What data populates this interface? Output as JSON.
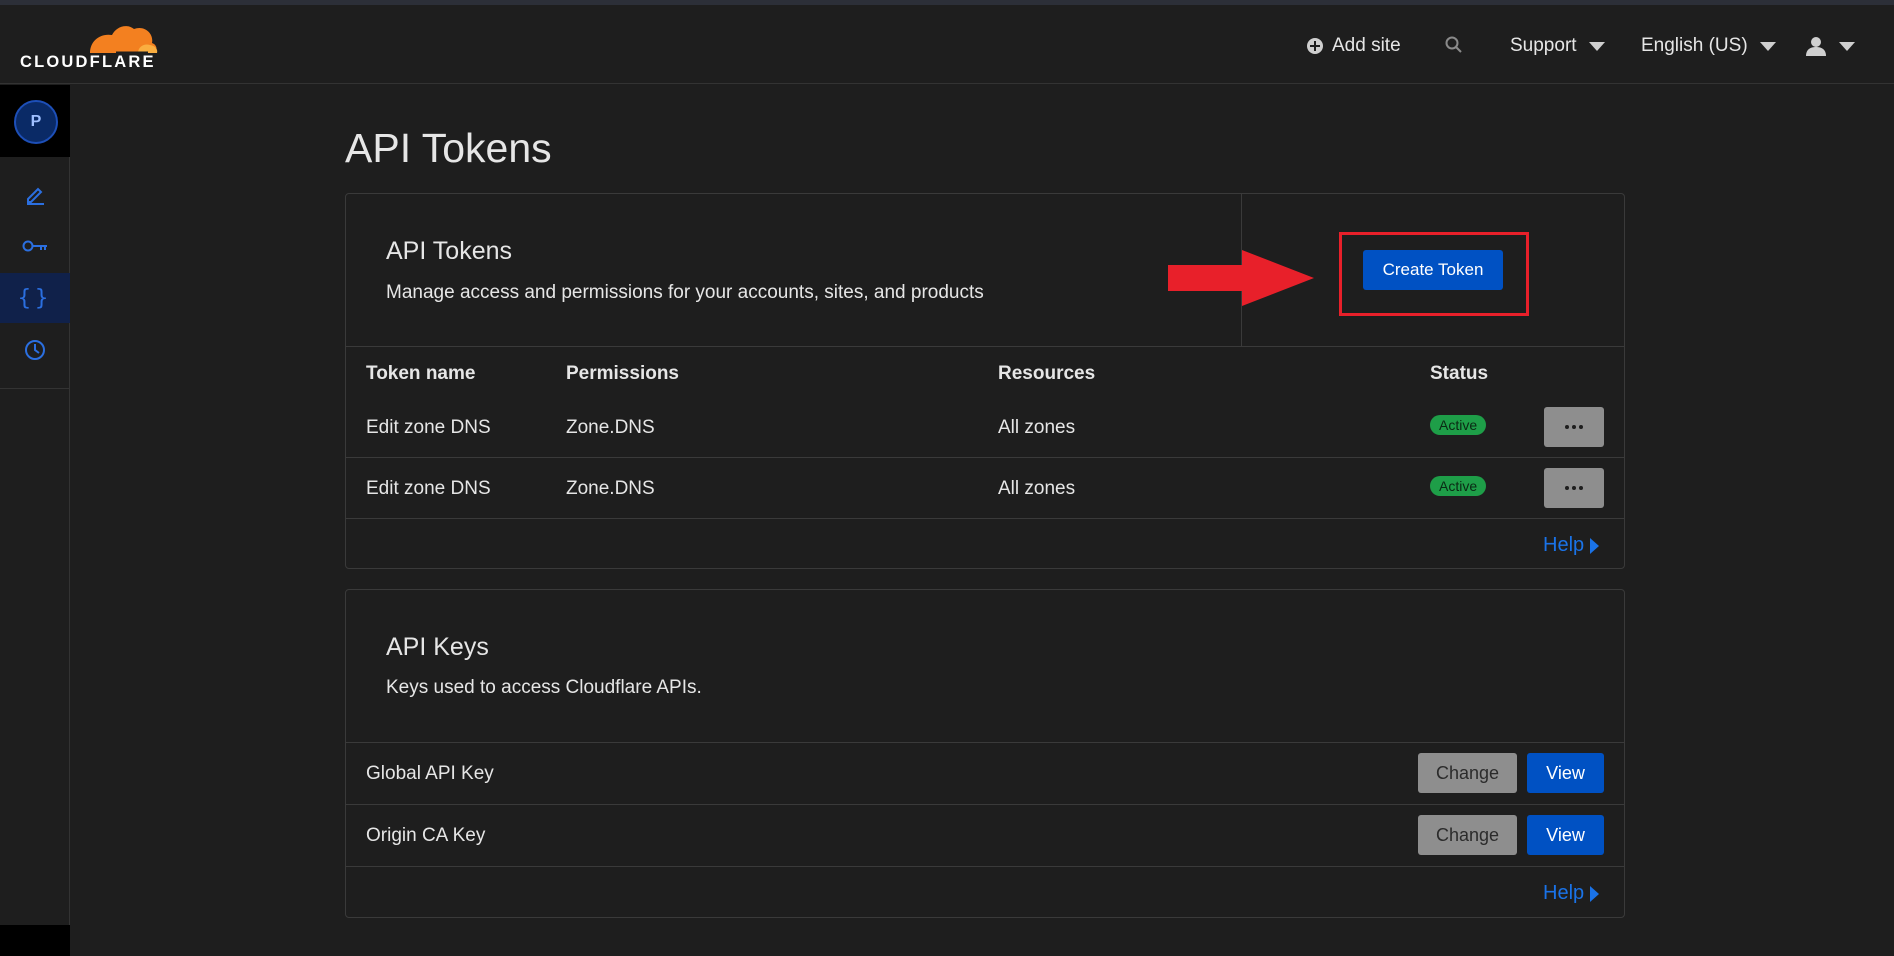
{
  "header": {
    "logo_text": "CLOUDFLARE",
    "add_site": "Add site",
    "support": "Support",
    "language": "English (US)"
  },
  "sidebar": {
    "avatar_initial": "P",
    "icons": [
      "edit-icon",
      "key-icon",
      "braces-icon",
      "clock-icon"
    ],
    "active_index": 2
  },
  "page": {
    "title": "API Tokens"
  },
  "tokens_card": {
    "title": "API Tokens",
    "description": "Manage access and permissions for your accounts, sites, and products",
    "create_button": "Create Token",
    "columns": [
      "Token name",
      "Permissions",
      "Resources",
      "Status"
    ],
    "rows": [
      {
        "name": "Edit zone DNS",
        "permissions": "Zone.DNS",
        "resources": "All zones",
        "status": "Active"
      },
      {
        "name": "Edit zone DNS",
        "permissions": "Zone.DNS",
        "resources": "All zones",
        "status": "Active"
      }
    ],
    "help": "Help"
  },
  "keys_card": {
    "title": "API Keys",
    "description": "Keys used to access Cloudflare APIs.",
    "rows": [
      {
        "name": "Global API Key",
        "change": "Change",
        "view": "View"
      },
      {
        "name": "Origin CA Key",
        "change": "Change",
        "view": "View"
      }
    ],
    "help": "Help"
  },
  "colors": {
    "accent": "#0051c3",
    "status_active": "#1e9e48",
    "annotation_red": "#e8202a",
    "logo_orange": "#f38020"
  }
}
